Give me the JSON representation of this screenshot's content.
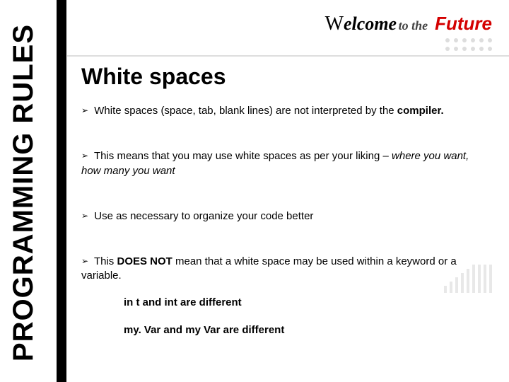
{
  "sidebar": {
    "label": "PROGRAMMING RULES"
  },
  "header": {
    "welcome_prefix": "W",
    "welcome_rest": "elcome",
    "to_the": " to the",
    "future": "Future"
  },
  "slide": {
    "title": "White spaces",
    "bullets": [
      {
        "prefix": "White spaces (space, tab, blank lines) are not interpreted by the ",
        "bold": "compiler.",
        "suffix": ""
      },
      {
        "prefix": "This means that you may use white spaces as per your liking – ",
        "italic": "where you want, how many you want",
        "suffix": ""
      },
      {
        "plain": "Use as necessary to organize your code better"
      },
      {
        "prefix": "This ",
        "bold": "DOES NOT",
        "suffix": " mean that a white space may be used within a keyword or a variable."
      }
    ],
    "subs": [
      "in t  and int are different",
      "my. Var and my Var are different"
    ]
  }
}
